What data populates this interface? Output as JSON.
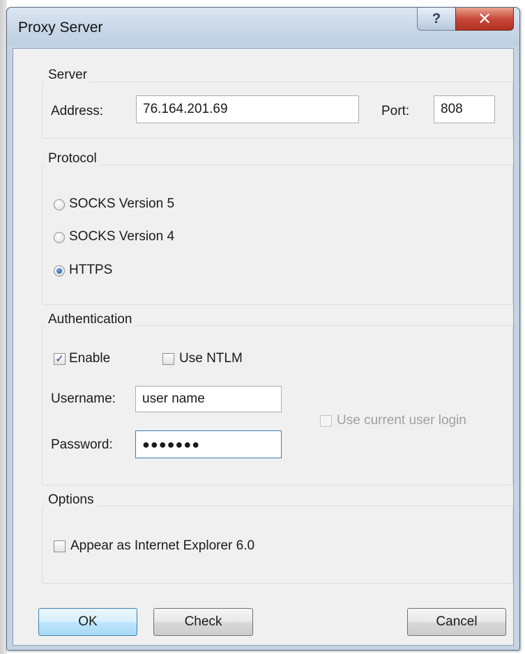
{
  "window": {
    "title": "Proxy Server",
    "help_label": "?",
    "close_label": "✕"
  },
  "server": {
    "group_label": "Server",
    "address_label": "Address:",
    "address_value": "76.164.201.69",
    "port_label": "Port:",
    "port_value": "808"
  },
  "protocol": {
    "group_label": "Protocol",
    "options": [
      {
        "label": "SOCKS Version 5",
        "selected": false
      },
      {
        "label": "SOCKS Version 4",
        "selected": false
      },
      {
        "label": "HTTPS",
        "selected": true
      }
    ]
  },
  "authentication": {
    "group_label": "Authentication",
    "enable_label": "Enable",
    "enable_checked": true,
    "use_ntlm_label": "Use NTLM",
    "use_ntlm_checked": false,
    "username_label": "Username:",
    "username_value": "user name",
    "password_label": "Password:",
    "password_value": "●●●●●●●",
    "use_current_login_label": "Use current user login",
    "use_current_login_checked": false
  },
  "options": {
    "group_label": "Options",
    "appear_ie_label": "Appear as Internet Explorer 6.0",
    "appear_ie_checked": false
  },
  "buttons": {
    "ok_label": "OK",
    "check_label": "Check",
    "cancel_label": "Cancel"
  },
  "colors": {
    "titlebar": "#c9d7e8",
    "close_button": "#c7493a",
    "default_button_border": "#3c7fb1",
    "check_mark": "#1d3f8f"
  }
}
